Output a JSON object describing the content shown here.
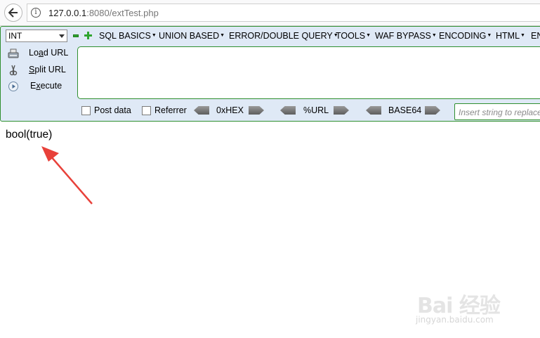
{
  "browser": {
    "url_host": "127.0.0.1",
    "url_rest": ":8080/extTest.php"
  },
  "hackbar": {
    "type_select": "INT",
    "menus": [
      "SQL BASICS",
      "UNION BASED",
      "ERROR/DOUBLE QUERY",
      "TOOLS",
      "WAF BYPASS",
      "ENCODING",
      "HTML",
      "EN"
    ],
    "load_url": {
      "pre": "Lo",
      "u": "a",
      "post": "d URL"
    },
    "split_url": {
      "pre": "",
      "u": "S",
      "post": "plit URL"
    },
    "execute": {
      "pre": "E",
      "u": "x",
      "post": "ecute"
    },
    "post_data_label": "Post data",
    "referrer_label": "Referrer",
    "hex_label": "0xHEX",
    "url_label": "%URL",
    "base64_label": "BASE64",
    "replace_placeholder": "Insert string to replace"
  },
  "page": {
    "output": "bool(true)"
  },
  "watermark": {
    "main": "Bai 经验",
    "sub": "jingyan.baidu.com"
  },
  "colors": {
    "hackbar_bg": "#dfe9f6",
    "hackbar_border": "#2f8f2f",
    "annotation_arrow": "#e8413a"
  }
}
